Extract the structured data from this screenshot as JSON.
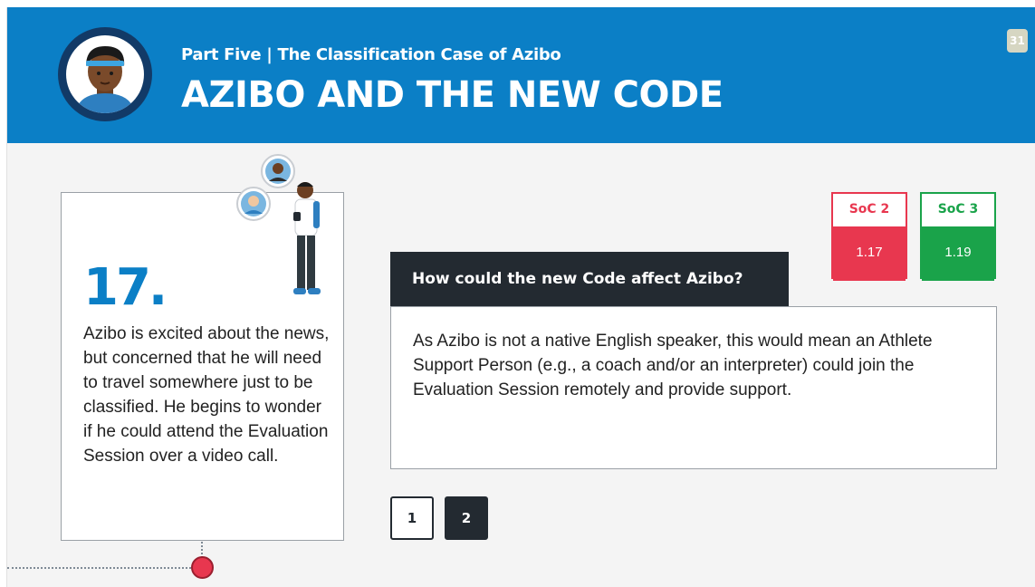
{
  "header": {
    "subtitle": "Part Five | The Classification Case of Azibo",
    "title": "AZIBO AND THE NEW CODE",
    "page_number": "31",
    "avatar_icon": "athlete-avatar-icon"
  },
  "story": {
    "number": "17.",
    "text": "Azibo is excited about the news, but concerned that he will need to travel somewhere just to be classified. He begins to wonder if he could attend the Evaluation Session over a video call.",
    "figure_icon": "athlete-on-phone-illustration"
  },
  "soc": [
    {
      "label": "SoC 2",
      "value": "1.17",
      "color": "#e8374f"
    },
    {
      "label": "SoC 3",
      "value": "1.19",
      "color": "#1aa34a"
    }
  ],
  "question": {
    "title": "How could the new Code affect Azibo?",
    "answer": "As Azibo is not a native English speaker, this would mean an Athlete Support Person (e.g., a coach and/or an interpreter) could join the Evaluation Session remotely and provide support."
  },
  "pagination": {
    "pages": [
      "1",
      "2"
    ],
    "active": "2"
  },
  "colors": {
    "header_blue": "#0b7fc6",
    "dark": "#232a31",
    "accent_red": "#e8374f",
    "accent_green": "#1aa34a"
  }
}
